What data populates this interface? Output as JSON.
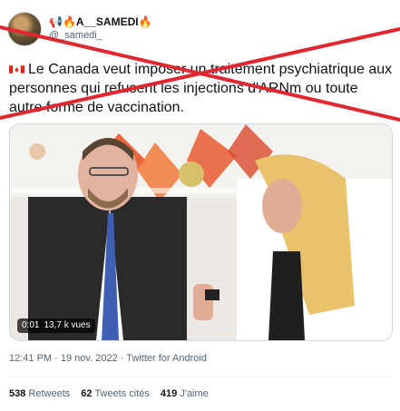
{
  "user": {
    "display_name": "📢🔥A__SAMEDI🔥",
    "handle": "@_samedi_"
  },
  "tweet": {
    "flag_icon": "canada-flag-icon",
    "text": "Le Canada veut imposer un traitement psychiatrique aux personnes qui refusent les injections d'ARNm ou toute autre forme de vaccination."
  },
  "media": {
    "duration": "0:01",
    "views": "13,7 k vues"
  },
  "meta": {
    "time": "12:41 PM",
    "date": "19 nov. 2022",
    "source": "Twitter for Android"
  },
  "stats": {
    "retweets_count": "538",
    "retweets_label": "Retweets",
    "quotes_count": "62",
    "quotes_label": "Tweets cités",
    "likes_count": "419",
    "likes_label": "J'aime"
  },
  "colors": {
    "cross_red": "#e0262f",
    "secondary_text": "#536471"
  }
}
